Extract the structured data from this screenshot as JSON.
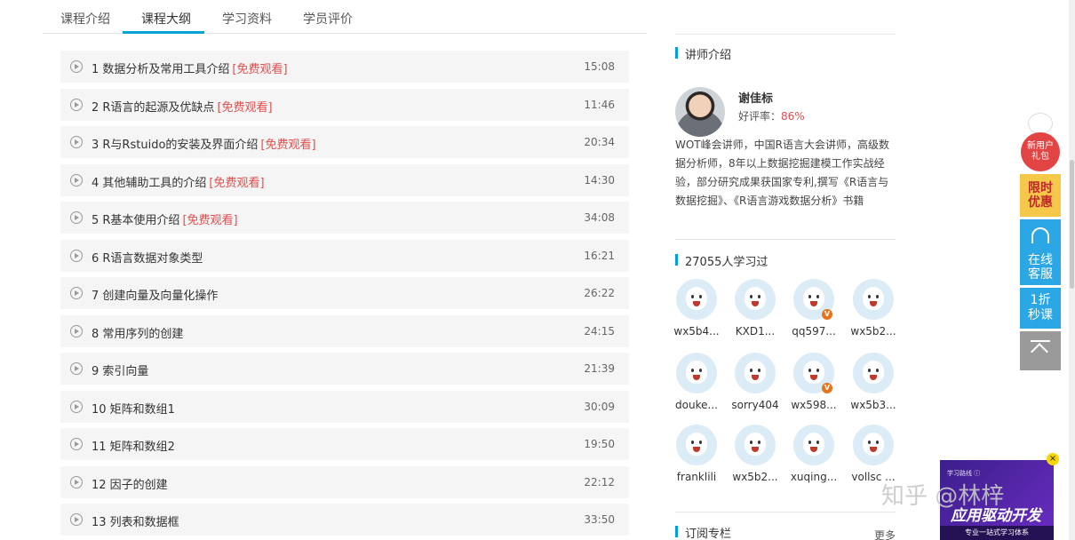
{
  "tabs": [
    {
      "label": "课程介绍"
    },
    {
      "label": "课程大纲"
    },
    {
      "label": "学习资料"
    },
    {
      "label": "学员评价"
    }
  ],
  "lessons": [
    {
      "title": "1 数据分析及常用工具介绍",
      "free": "[免费观看]",
      "duration": "15:08"
    },
    {
      "title": "2 R语言的起源及优缺点",
      "free": "[免费观看]",
      "duration": "11:46"
    },
    {
      "title": "3 R与Rstuido的安装及界面介绍",
      "free": "[免费观看]",
      "duration": "20:34"
    },
    {
      "title": "4 其他辅助工具的介绍",
      "free": "[免费观看]",
      "duration": "14:30"
    },
    {
      "title": "5 R基本使用介绍",
      "free": "[免费观看]",
      "duration": "34:08"
    },
    {
      "title": "6 R语言数据对象类型",
      "free": "",
      "duration": "16:21"
    },
    {
      "title": "7 创建向量及向量化操作",
      "free": "",
      "duration": "26:22"
    },
    {
      "title": "8 常用序列的创建",
      "free": "",
      "duration": "24:15"
    },
    {
      "title": "9 索引向量",
      "free": "",
      "duration": "21:39"
    },
    {
      "title": "10 矩阵和数组1",
      "free": "",
      "duration": "30:09"
    },
    {
      "title": "11 矩阵和数组2",
      "free": "",
      "duration": "19:50"
    },
    {
      "title": "12 因子的创建",
      "free": "",
      "duration": "22:12"
    },
    {
      "title": "13 列表和数据框",
      "free": "",
      "duration": "33:50"
    }
  ],
  "teacher": {
    "section_title": "讲师介绍",
    "name": "谢佳标",
    "rating_label": "好评率：",
    "rating_value": "86%",
    "bio": "WOT峰会讲师，中国R语言大会讲师，高级数据分析师，8年以上数据挖掘建模工作实战经验，部分研究成果获国家专利,撰写《R语言与数据挖掘》、《R语言游戏数据分析》书籍"
  },
  "learners": {
    "section_title": "27055人学习过",
    "items": [
      {
        "name": "wx5b4...",
        "vip": ""
      },
      {
        "name": "KXD1...",
        "vip": ""
      },
      {
        "name": "qq597...",
        "vip": "V"
      },
      {
        "name": "wx5b2...",
        "vip": ""
      },
      {
        "name": "douke...",
        "vip": ""
      },
      {
        "name": "sorry404",
        "vip": ""
      },
      {
        "name": "wx598...",
        "vip": "V"
      },
      {
        "name": "wx5b3...",
        "vip": ""
      },
      {
        "name": "franklili",
        "vip": ""
      },
      {
        "name": "wx5b2...",
        "vip": ""
      },
      {
        "name": "xuqing...",
        "vip": ""
      },
      {
        "name": "vollsc ...",
        "vip": ""
      }
    ]
  },
  "column": {
    "section_title": "订阅专栏",
    "more": "更多"
  },
  "side": {
    "gift": "新用户\n礼包",
    "limit_line1": "限时",
    "limit_line2": "优惠",
    "service_line1": "在线",
    "service_line2": "客服",
    "discount_line1": "1折",
    "discount_line2": "秒课"
  },
  "ad": {
    "small": "学习路线 ⓘ",
    "big": "应用驱动开发",
    "bar": "专业一站式学习体系",
    "close": "×"
  },
  "watermark": "知乎 @林梓",
  "colors": {
    "accent": "#00a2d8",
    "free": "#e24d4d",
    "service": "#2ba7e5"
  }
}
